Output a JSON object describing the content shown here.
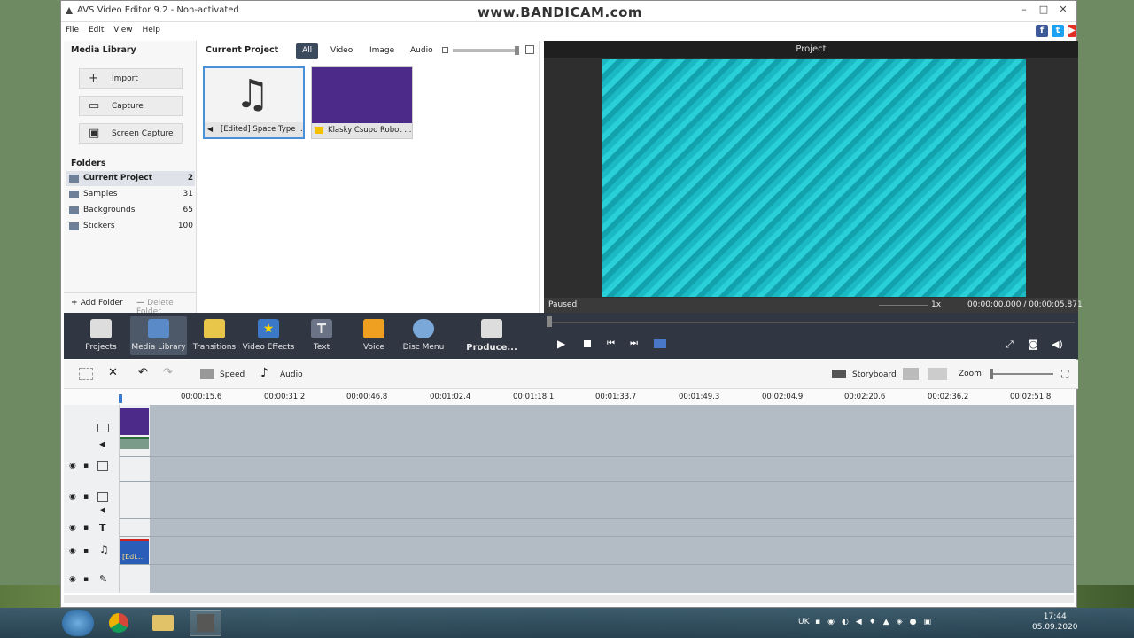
{
  "window": {
    "title": "AVS Video Editor 9.2 - Non-activated",
    "watermark": "www.BANDICAM.com"
  },
  "menu": {
    "file": "File",
    "edit": "Edit",
    "view": "View",
    "help": "Help"
  },
  "media_library": {
    "title": "Media Library",
    "buttons": {
      "import": "Import",
      "capture": "Capture",
      "screen_capture": "Screen Capture"
    },
    "folders_title": "Folders",
    "folders": [
      {
        "label": "Current Project",
        "count": "2"
      },
      {
        "label": "Samples",
        "count": "31"
      },
      {
        "label": "Backgrounds",
        "count": "65"
      },
      {
        "label": "Stickers",
        "count": "100"
      }
    ],
    "add_folder": "Add Folder",
    "delete_folder": "Delete Folder"
  },
  "current_project": {
    "title": "Current Project",
    "filters": {
      "all": "All",
      "video": "Video",
      "image": "Image",
      "audio": "Audio"
    },
    "items": [
      {
        "label": "[Edited] Space Type ..."
      },
      {
        "label": "Klasky Csupo Robot ..."
      }
    ]
  },
  "preview": {
    "title": "Project",
    "status": "Paused",
    "speed": "1x",
    "time": "00:00:00.000  /  00:00:05.871"
  },
  "toolbar": {
    "projects": "Projects",
    "media_library": "Media Library",
    "transitions": "Transitions",
    "video_effects": "Video Effects",
    "text": "Text",
    "voice": "Voice",
    "disc_menu": "Disc Menu",
    "produce": "Produce..."
  },
  "timeline": {
    "speed": "Speed",
    "audio": "Audio",
    "storyboard": "Storyboard",
    "zoom": "Zoom:",
    "ruler": [
      "00:00:15.6",
      "00:00:31.2",
      "00:00:46.8",
      "00:01:02.4",
      "00:01:18.1",
      "00:01:33.7",
      "00:01:49.3",
      "00:02:04.9",
      "00:02:20.6",
      "00:02:36.2",
      "00:02:51.8"
    ],
    "audio_clip_label": "[Edi..."
  },
  "taskbar": {
    "lang": "UK",
    "time": "17:44",
    "date": "05.09.2020"
  },
  "colors": {
    "toolbar_bg": "#303743",
    "preview_accent": "#1bb9c4",
    "clip_purple": "#4b2a8a"
  }
}
